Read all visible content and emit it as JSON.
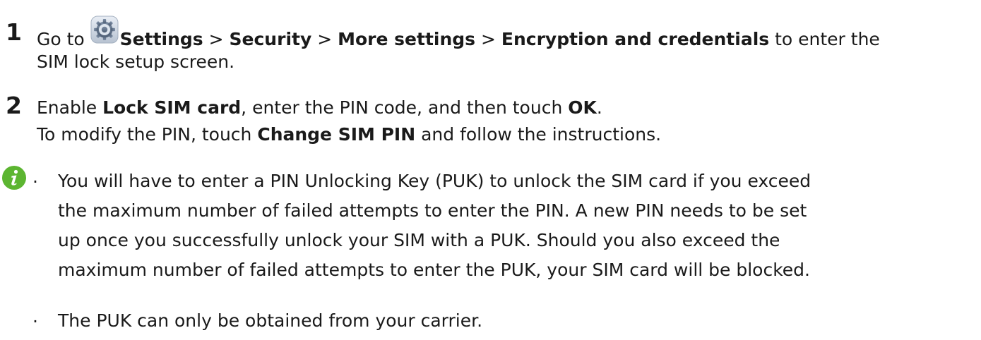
{
  "steps": [
    {
      "number": "1",
      "line1_prefix": "Go to ",
      "icon": "settings-gear-icon",
      "path": [
        {
          "text": "Settings",
          "bold": true
        },
        {
          "text": " > ",
          "bold": false
        },
        {
          "text": "Security",
          "bold": true
        },
        {
          "text": " > ",
          "bold": false
        },
        {
          "text": "More settings",
          "bold": true
        },
        {
          "text": " > ",
          "bold": false
        },
        {
          "text": "Encryption and credentials",
          "bold": true
        },
        {
          "text": " to enter the",
          "bold": false
        }
      ],
      "line2": "SIM lock setup screen."
    },
    {
      "number": "2",
      "line1_a": "Enable ",
      "line1_b": "Lock SIM card",
      "line1_c": ", enter the PIN code, and then touch ",
      "line1_d": "OK",
      "line1_e": ".",
      "line2_a": "To modify the PIN, touch ",
      "line2_b": "Change SIM PIN",
      "line2_c": " and follow the instructions."
    }
  ],
  "note": {
    "icon": "info-icon",
    "bullets": [
      {
        "lines": [
          "You will have to enter a PIN Unlocking Key (PUK) to unlock the SIM card if you exceed",
          "the maximum number of failed attempts to enter the PIN. A new PIN needs to be set",
          "up once you successfully unlock your SIM with a PUK. Should you also exceed the",
          "maximum number of failed attempts to enter the PUK, your SIM card will be blocked."
        ]
      },
      {
        "lines": [
          "The PUK can only be obtained from your carrier."
        ]
      }
    ]
  },
  "colors": {
    "text": "#1a1a1a",
    "info_icon": "#5cb531"
  }
}
